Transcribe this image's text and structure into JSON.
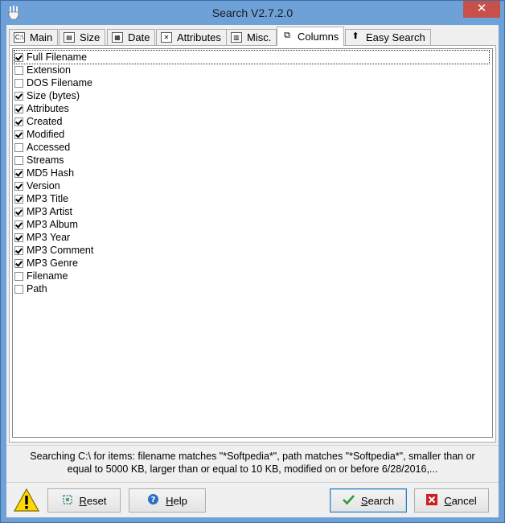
{
  "window": {
    "title": "Search V2.7.2.0",
    "close_glyph": "✕"
  },
  "tabs": [
    {
      "label": "Main",
      "icon": "drive-icon",
      "icon_text": "C:\\"
    },
    {
      "label": "Size",
      "icon": "size-icon",
      "icon_text": "▤"
    },
    {
      "label": "Date",
      "icon": "calendar-icon",
      "icon_text": "▦"
    },
    {
      "label": "Attributes",
      "icon": "attributes-icon",
      "icon_text": "✕"
    },
    {
      "label": "Misc.",
      "icon": "misc-icon",
      "icon_text": "▥"
    },
    {
      "label": "Columns",
      "icon": "columns-icon",
      "icon_text": "⧉",
      "active": true
    },
    {
      "label": "Easy Search",
      "icon": "up-arrow-icon",
      "icon_text": "⬆"
    }
  ],
  "columns": [
    {
      "label": "Full Filename",
      "checked": true
    },
    {
      "label": "Extension",
      "checked": false
    },
    {
      "label": "DOS Filename",
      "checked": false
    },
    {
      "label": "Size (bytes)",
      "checked": true
    },
    {
      "label": "Attributes",
      "checked": true
    },
    {
      "label": "Created",
      "checked": true
    },
    {
      "label": "Modified",
      "checked": true
    },
    {
      "label": "Accessed",
      "checked": false
    },
    {
      "label": "Streams",
      "checked": false
    },
    {
      "label": "MD5 Hash",
      "checked": true
    },
    {
      "label": "Version",
      "checked": true
    },
    {
      "label": "MP3 Title",
      "checked": true
    },
    {
      "label": "MP3 Artist",
      "checked": true
    },
    {
      "label": "MP3 Album",
      "checked": true
    },
    {
      "label": "MP3 Year",
      "checked": true
    },
    {
      "label": "MP3 Comment",
      "checked": true
    },
    {
      "label": "MP3 Genre",
      "checked": true
    },
    {
      "label": "Filename",
      "checked": false
    },
    {
      "label": "Path",
      "checked": false
    }
  ],
  "status": {
    "line1": "Searching C:\\ for items: filename matches \"*Softpedia*\", path matches \"*Softpedia*\", smaller than or",
    "line2": "equal to 5000 KB, larger than or equal to 10 KB, modified on or before 6/28/2016,..."
  },
  "buttons": {
    "reset": {
      "mnemonic": "R",
      "rest": "eset"
    },
    "help": {
      "mnemonic": "H",
      "rest": "elp"
    },
    "search": {
      "mnemonic": "S",
      "rest": "earch"
    },
    "cancel": {
      "mnemonic": "C",
      "rest": "ancel"
    }
  },
  "colors": {
    "titlebar": "#6ea1d8",
    "close": "#c7504b",
    "check_icon": "#2e9b2e",
    "cancel_icon": "#cc2020"
  }
}
